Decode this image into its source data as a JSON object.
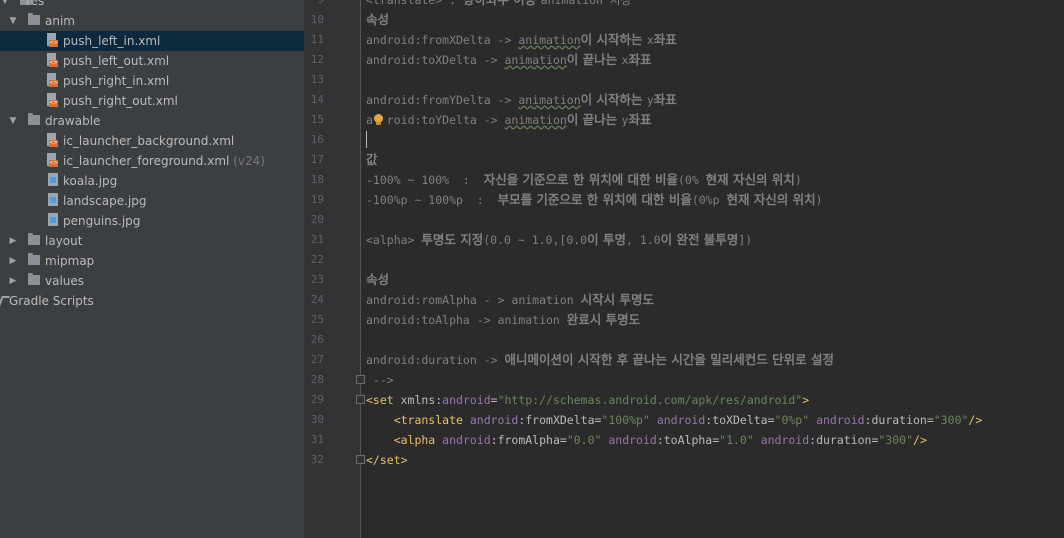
{
  "project_tree": [
    {
      "label": "res",
      "kind": "folder",
      "expanded": true,
      "indent": 0
    },
    {
      "label": "anim",
      "kind": "folder",
      "expanded": true,
      "indent": 1
    },
    {
      "label": "push_left_in.xml",
      "kind": "xml",
      "indent": 2,
      "selected": true
    },
    {
      "label": "push_left_out.xml",
      "kind": "xml",
      "indent": 2
    },
    {
      "label": "push_right_in.xml",
      "kind": "xml",
      "indent": 2
    },
    {
      "label": "push_right_out.xml",
      "kind": "xml",
      "indent": 2
    },
    {
      "label": "drawable",
      "kind": "folder",
      "expanded": true,
      "indent": 1
    },
    {
      "label": "ic_launcher_background.xml",
      "kind": "xml",
      "indent": 2
    },
    {
      "label": "ic_launcher_foreground.xml",
      "kind": "xml",
      "indent": 2,
      "hint": "(v24)"
    },
    {
      "label": "koala.jpg",
      "kind": "image",
      "indent": 2
    },
    {
      "label": "landscape.jpg",
      "kind": "image",
      "indent": 2
    },
    {
      "label": "penguins.jpg",
      "kind": "image",
      "indent": 2
    },
    {
      "label": "layout",
      "kind": "folder",
      "expanded": false,
      "indent": 1
    },
    {
      "label": "mipmap",
      "kind": "folder",
      "expanded": false,
      "indent": 1
    },
    {
      "label": "values",
      "kind": "folder",
      "expanded": false,
      "indent": 1
    },
    {
      "label": "Gradle Scripts",
      "kind": "gradle",
      "indent": 0
    }
  ],
  "editor": {
    "caret_line": 15,
    "lines": [
      {
        "n": 9,
        "parts": [
          [
            "<translate> : ",
            "c"
          ],
          [
            "상하좌우 이동 ",
            "k"
          ],
          [
            "animation 지정",
            "c"
          ]
        ]
      },
      {
        "n": 10,
        "parts": [
          [
            "속성",
            "k"
          ]
        ]
      },
      {
        "n": 11,
        "parts": [
          [
            "android:fromXDelta -> ",
            "c"
          ],
          [
            "animation",
            "w"
          ],
          [
            "이 시작하는 ",
            "k"
          ],
          [
            "x",
            "c"
          ],
          [
            "좌표",
            "k"
          ]
        ]
      },
      {
        "n": 12,
        "parts": [
          [
            "android:toXDelta -> ",
            "c"
          ],
          [
            "animation",
            "w"
          ],
          [
            "이 끝나는 ",
            "k"
          ],
          [
            "x",
            "c"
          ],
          [
            "좌표",
            "k"
          ]
        ]
      },
      {
        "n": 13,
        "parts": []
      },
      {
        "n": 14,
        "parts": [
          [
            "android:fromYDelta -> ",
            "c"
          ],
          [
            "animation",
            "w"
          ],
          [
            "이 시작하는 ",
            "k"
          ],
          [
            "y",
            "c"
          ],
          [
            "좌표",
            "k"
          ]
        ]
      },
      {
        "n": 15,
        "parts": [
          [
            "a",
            "c"
          ],
          [
            "  ",
            "c"
          ],
          [
            "roid:toYDelta -> ",
            "c"
          ],
          [
            "animation",
            "w"
          ],
          [
            "이 끝나는 ",
            "k"
          ],
          [
            "y",
            "c"
          ],
          [
            "좌표",
            "k"
          ]
        ]
      },
      {
        "n": 16,
        "parts": []
      },
      {
        "n": 17,
        "parts": [
          [
            "값",
            "k"
          ]
        ]
      },
      {
        "n": 18,
        "parts": [
          [
            "-100% ~ 100%  :  ",
            "c"
          ],
          [
            "자신을 기준으로 한 위치에 대한 비율",
            "k"
          ],
          [
            "(0% ",
            "c"
          ],
          [
            "현재 자신의 위치",
            "k"
          ],
          [
            ")",
            "c"
          ]
        ]
      },
      {
        "n": 19,
        "parts": [
          [
            "-100%p ~ 100%p  :  ",
            "c"
          ],
          [
            "부모를 기준으로 한 위치에 대한 비율",
            "k"
          ],
          [
            "(0%p ",
            "c"
          ],
          [
            "현재 자신의 위치",
            "k"
          ],
          [
            ")",
            "c"
          ]
        ]
      },
      {
        "n": 20,
        "parts": []
      },
      {
        "n": 21,
        "parts": [
          [
            "<alpha> ",
            "c"
          ],
          [
            "투명도 지정",
            "k"
          ],
          [
            "(0.0 ~ 1.0,[0.0",
            "c"
          ],
          [
            "이 투명",
            "k"
          ],
          [
            ", 1.0",
            "c"
          ],
          [
            "이 완전 불투명",
            "k"
          ],
          [
            "])",
            "c"
          ]
        ]
      },
      {
        "n": 22,
        "parts": []
      },
      {
        "n": 23,
        "parts": [
          [
            "속성",
            "k"
          ]
        ]
      },
      {
        "n": 24,
        "parts": [
          [
            "android:romAlpha - > animation ",
            "c"
          ],
          [
            "시작시 투명도",
            "k"
          ]
        ]
      },
      {
        "n": 25,
        "parts": [
          [
            "android:toAlpha -> animation ",
            "c"
          ],
          [
            "완료시 투명도",
            "k"
          ]
        ]
      },
      {
        "n": 26,
        "parts": []
      },
      {
        "n": 27,
        "parts": [
          [
            "android:duration -> ",
            "c"
          ],
          [
            "애니메이션이 시작한 후 끝나는 시간을 밀리세컨드 단위로 설정",
            "k"
          ]
        ]
      },
      {
        "n": 28,
        "parts": [
          [
            " -->",
            "c"
          ]
        ]
      },
      {
        "n": 29,
        "parts": [
          [
            "<set ",
            "tag"
          ],
          [
            "xmlns:",
            "attr"
          ],
          [
            "android",
            "ns"
          ],
          [
            "=",
            "attr"
          ],
          [
            "\"http://schemas.android.com/apk/res/android\"",
            "str"
          ],
          [
            ">",
            "tag"
          ]
        ]
      },
      {
        "n": 30,
        "parts": [
          [
            "    <translate ",
            "tag"
          ],
          [
            "android",
            "ns"
          ],
          [
            ":fromXDelta=",
            "attr"
          ],
          [
            "\"100%p\" ",
            "str"
          ],
          [
            "android",
            "ns"
          ],
          [
            ":toXDelta=",
            "attr"
          ],
          [
            "\"0%p\" ",
            "str"
          ],
          [
            "android",
            "ns"
          ],
          [
            ":duration=",
            "attr"
          ],
          [
            "\"300\"",
            "str"
          ],
          [
            "/>",
            "tag"
          ]
        ]
      },
      {
        "n": 31,
        "parts": [
          [
            "    <alpha ",
            "tag"
          ],
          [
            "android",
            "ns"
          ],
          [
            ":fromAlpha=",
            "attr"
          ],
          [
            "\"0.0\" ",
            "str"
          ],
          [
            "android",
            "ns"
          ],
          [
            ":toAlpha=",
            "attr"
          ],
          [
            "\"1.0\" ",
            "str"
          ],
          [
            "android",
            "ns"
          ],
          [
            ":duration=",
            "attr"
          ],
          [
            "\"300\"",
            "str"
          ],
          [
            "/>",
            "tag"
          ]
        ]
      },
      {
        "n": 32,
        "parts": [
          [
            "</set>",
            "tag"
          ]
        ]
      }
    ]
  }
}
